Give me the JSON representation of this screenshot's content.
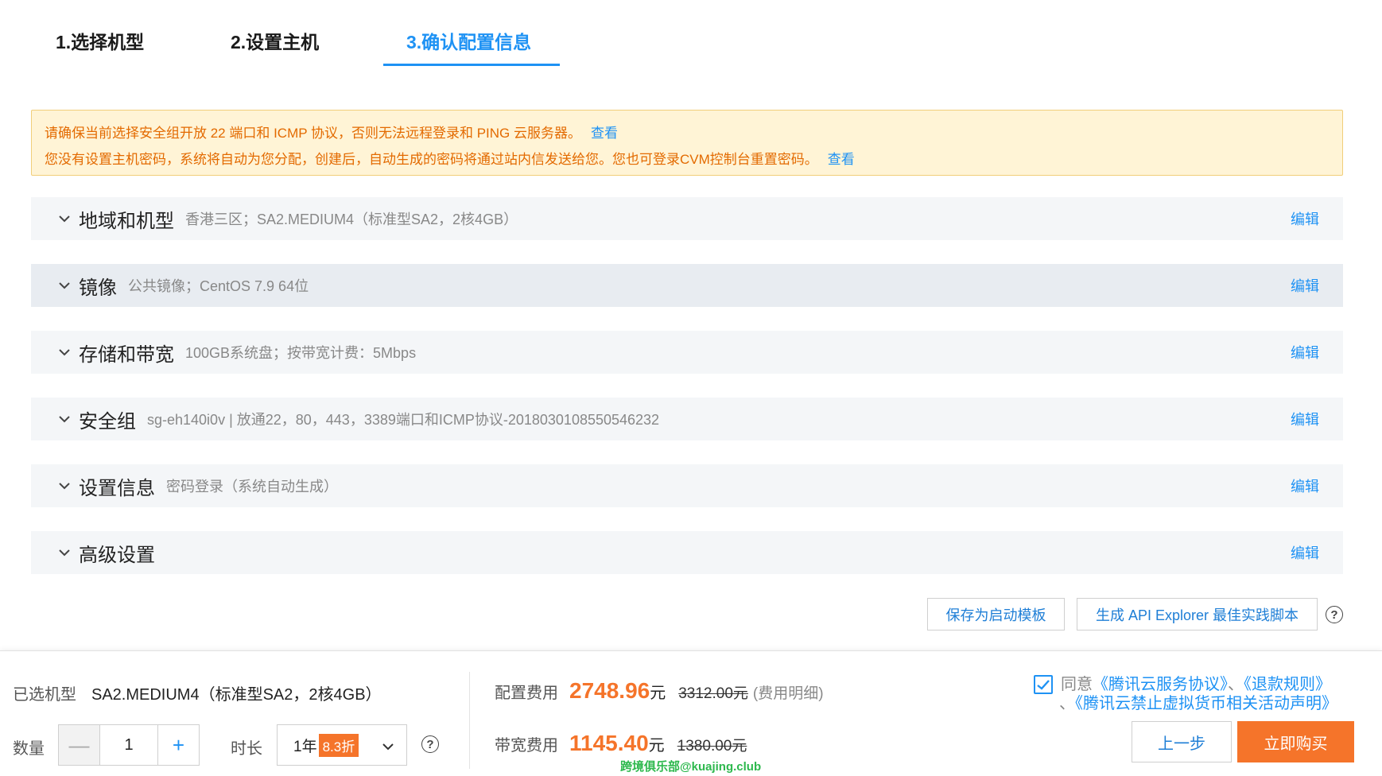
{
  "steps": [
    {
      "label": "1.选择机型"
    },
    {
      "label": "2.设置主机"
    },
    {
      "label": "3.确认配置信息"
    }
  ],
  "notice": {
    "line1": "请确保当前选择安全组开放 22 端口和 ICMP 协议，否则无法远程登录和 PING 云服务器。",
    "line1_link": "查看",
    "line2": "您没有设置主机密码，系统将自动为您分配，创建后，自动生成的密码将通过站内信发送给您。您也可登录CVM控制台重置密码。",
    "line2_link": "查看"
  },
  "sections": [
    {
      "title": "地域和机型",
      "desc": "香港三区；SA2.MEDIUM4（标准型SA2，2核4GB）",
      "edit": "编辑"
    },
    {
      "title": "镜像",
      "desc": "公共镜像；CentOS 7.9 64位",
      "edit": "编辑"
    },
    {
      "title": "存储和带宽",
      "desc": "100GB系统盘；按带宽计费：5Mbps",
      "edit": "编辑"
    },
    {
      "title": "安全组",
      "desc": "sg-eh140i0v | 放通22，80，443，3389端口和ICMP协议-20180301085505462​32",
      "edit": "编辑"
    },
    {
      "title": "设置信息",
      "desc": "密码登录（系统自动生成）",
      "edit": "编辑"
    },
    {
      "title": "高级设置",
      "desc": "",
      "edit": "编辑"
    }
  ],
  "actions": {
    "save_template": "保存为启动模板",
    "api_explorer": "生成 API Explorer 最佳实践脚本",
    "help": "?"
  },
  "footer": {
    "selected_label": "已选机型",
    "selected_value": "SA2.MEDIUM4（标准型SA2，2核4GB）",
    "qty_label": "数量",
    "qty_minus": "—",
    "qty_value": "1",
    "qty_plus": "+",
    "duration_label": "时长",
    "duration_value": "1年",
    "duration_badge": "8.3折",
    "help": "?",
    "config_fee_label": "配置费用",
    "config_fee": "2748.96",
    "config_unit": "元",
    "config_orig": "3312.00元",
    "config_detail": "(费用明细)",
    "bandwidth_fee_label": "带宽费用",
    "bandwidth_fee": "1145.40",
    "bandwidth_unit": "元",
    "bandwidth_orig": "1380.00元",
    "agree_prefix": "同意",
    "agree_link1": "《腾讯云服务协议》",
    "agree_sep1": "、",
    "agree_link2": "《退款规则》",
    "agree_sep2": "、",
    "agree_link3": "《腾讯云禁止虚拟货币相关活动声明》",
    "prev_button": "上一步",
    "buy_button": "立即购买",
    "watermark": "跨境俱乐部@kuajing.club"
  },
  "colors": {
    "accent": "#1e92f4",
    "orange": "#f5742a",
    "notice_bg": "#fff4d6"
  }
}
